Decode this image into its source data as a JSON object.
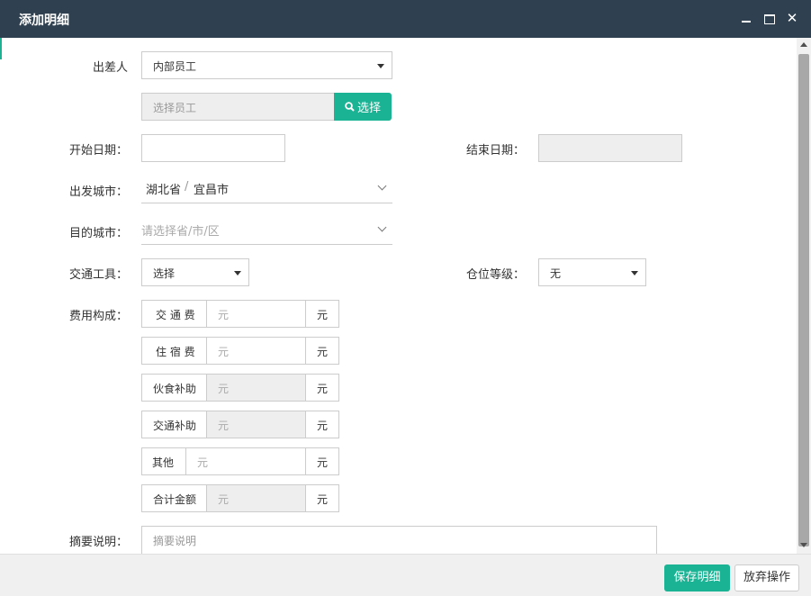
{
  "dialog": {
    "title": "添加明细",
    "controls": {
      "minimize_icon": "minimize-icon",
      "maximize_icon": "maximize-icon",
      "close_glyph": "✕"
    }
  },
  "form": {
    "traveler": {
      "label": "出差人",
      "value": "内部员工"
    },
    "employee": {
      "placeholder": "选择员工",
      "button_label": "选择",
      "button_icon": "search-icon"
    },
    "start_date": {
      "label": "开始日期：",
      "value": ""
    },
    "end_date": {
      "label": "结束日期：",
      "value": ""
    },
    "departure_city": {
      "label": "出发城市：",
      "province": "湖北省",
      "separator": "/",
      "city": "宜昌市"
    },
    "destination_city": {
      "label": "目的城市：",
      "placeholder": "请选择省/市/区"
    },
    "transport": {
      "label": "交通工具：",
      "value": "选择"
    },
    "seat_class": {
      "label": "仓位等级：",
      "value": "无"
    },
    "fees": {
      "label": "费用构成：",
      "rows": [
        {
          "name": "交 通 费",
          "placeholder": "元",
          "unit": "元",
          "disabled": false
        },
        {
          "name": "住 宿 费",
          "placeholder": "元",
          "unit": "元",
          "disabled": false
        },
        {
          "name": "伙食补助",
          "placeholder": "元",
          "unit": "元",
          "disabled": true
        },
        {
          "name": "交通补助",
          "placeholder": "元",
          "unit": "元",
          "disabled": true
        },
        {
          "name": "其他",
          "placeholder": "元",
          "unit": "元",
          "disabled": false
        },
        {
          "name": "合计金额",
          "placeholder": "元",
          "unit": "元",
          "disabled": true
        }
      ]
    },
    "summary": {
      "label": "摘要说明：",
      "placeholder": "摘要说明"
    }
  },
  "footer": {
    "save_label": "保存明细",
    "cancel_label": "放弃操作"
  },
  "colors": {
    "titlebar": "#2f4050",
    "accent": "#1ab394",
    "footer": "#f0f0f0"
  }
}
